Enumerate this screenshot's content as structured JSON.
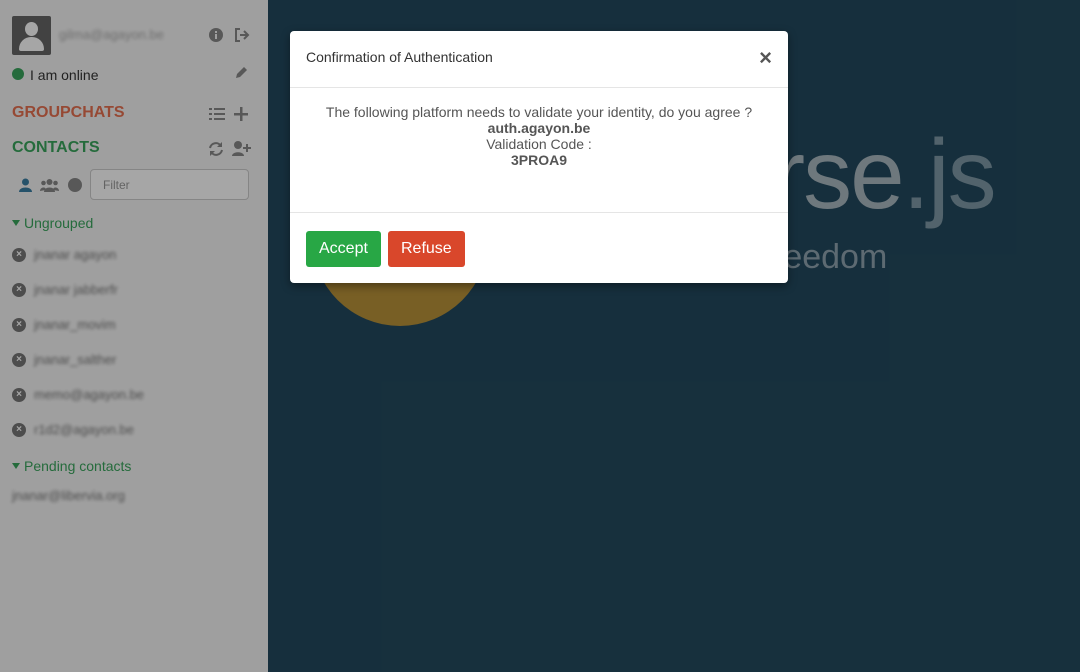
{
  "sidebar": {
    "profile": {
      "jid": "gilma@agayon.be",
      "status_text": "I am online"
    },
    "groupchats_title": "GROUPCHATS",
    "contacts_title": "CONTACTS",
    "filter_placeholder": "Filter",
    "groups": [
      {
        "name": "Ungrouped",
        "contacts": [
          "jnanar agayon",
          "jnanar jabberfr",
          "jnanar_movim",
          "jnanar_salther",
          "memo@agayon.be",
          "r1d2@agayon.be"
        ]
      },
      {
        "name": "Pending contacts",
        "contacts": [
          "jnanar@libervia.org"
        ]
      }
    ]
  },
  "brand": {
    "word": "erse",
    "suffix": ".js",
    "tagline": "reedom"
  },
  "modal": {
    "title": "Confirmation of Authentication",
    "close_symbol": "×",
    "message": "The following platform needs to validate your identity, do you agree ?",
    "platform": "auth.agayon.be",
    "code_label": "Validation Code :",
    "code": "3PROA9",
    "accept_label": "Accept",
    "refuse_label": "Refuse"
  },
  "colors": {
    "online": "#3aa55d",
    "groupchats": "#e77051",
    "accept": "#28a745",
    "refuse": "#d9472b",
    "background": "#23495e"
  }
}
